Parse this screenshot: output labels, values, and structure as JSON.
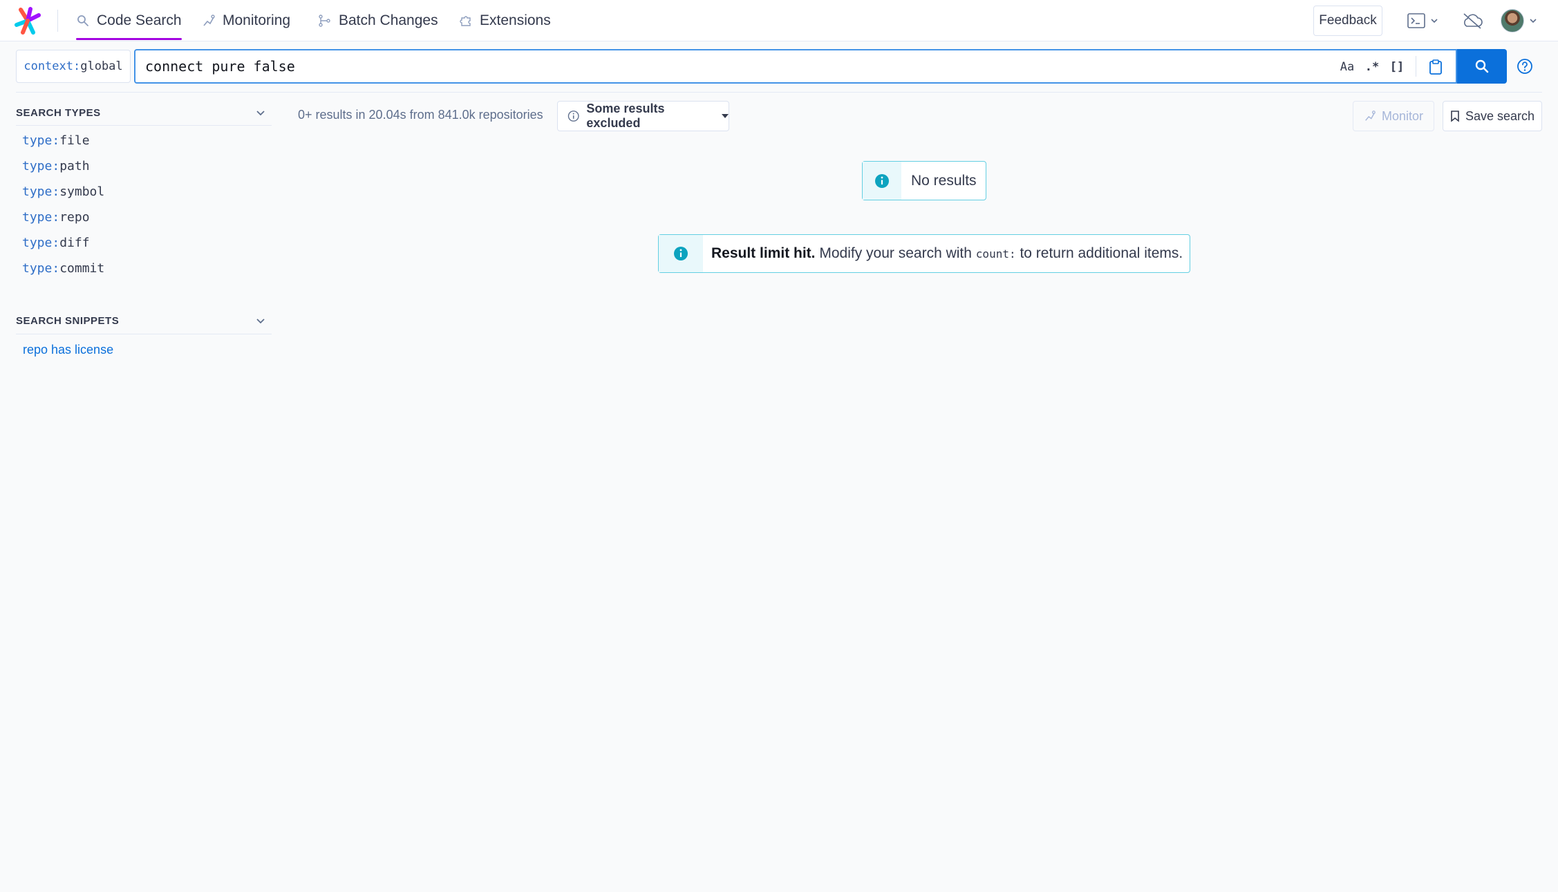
{
  "nav": {
    "items": [
      {
        "label": "Code Search",
        "icon": "search-icon",
        "active": true
      },
      {
        "label": "Monitoring",
        "icon": "monitoring-icon",
        "active": false
      },
      {
        "label": "Batch Changes",
        "icon": "batch-changes-icon",
        "active": false
      },
      {
        "label": "Extensions",
        "icon": "puzzle-icon",
        "active": false
      }
    ],
    "feedback_label": "Feedback"
  },
  "search": {
    "context_key": "context:",
    "context_value": "global",
    "query": "connect pure false",
    "case_toggle_label": "Aa",
    "regex_toggle_label": ".*",
    "structural_toggle_label": "[]"
  },
  "sidebar": {
    "search_types_title": "SEARCH TYPES",
    "types": [
      {
        "key": "type:",
        "value": "file"
      },
      {
        "key": "type:",
        "value": "path"
      },
      {
        "key": "type:",
        "value": "symbol"
      },
      {
        "key": "type:",
        "value": "repo"
      },
      {
        "key": "type:",
        "value": "diff"
      },
      {
        "key": "type:",
        "value": "commit"
      }
    ],
    "snippets_title": "SEARCH SNIPPETS",
    "snippets": [
      "repo has license"
    ]
  },
  "results": {
    "summary": "0+ results in 20.04s from 841.0k repositories",
    "excluded_label": "Some results excluded",
    "monitor_label": "Monitor",
    "save_label": "Save search",
    "no_results": "No results",
    "limit_bold": "Result limit hit.",
    "limit_pre": "Modify your search with",
    "limit_code": "count:",
    "limit_post": "to return additional items."
  },
  "colors": {
    "accent": "#a305e1",
    "primary": "#0b70db",
    "info_border": "#63cfe2",
    "info_icon": "#0da3bf"
  }
}
